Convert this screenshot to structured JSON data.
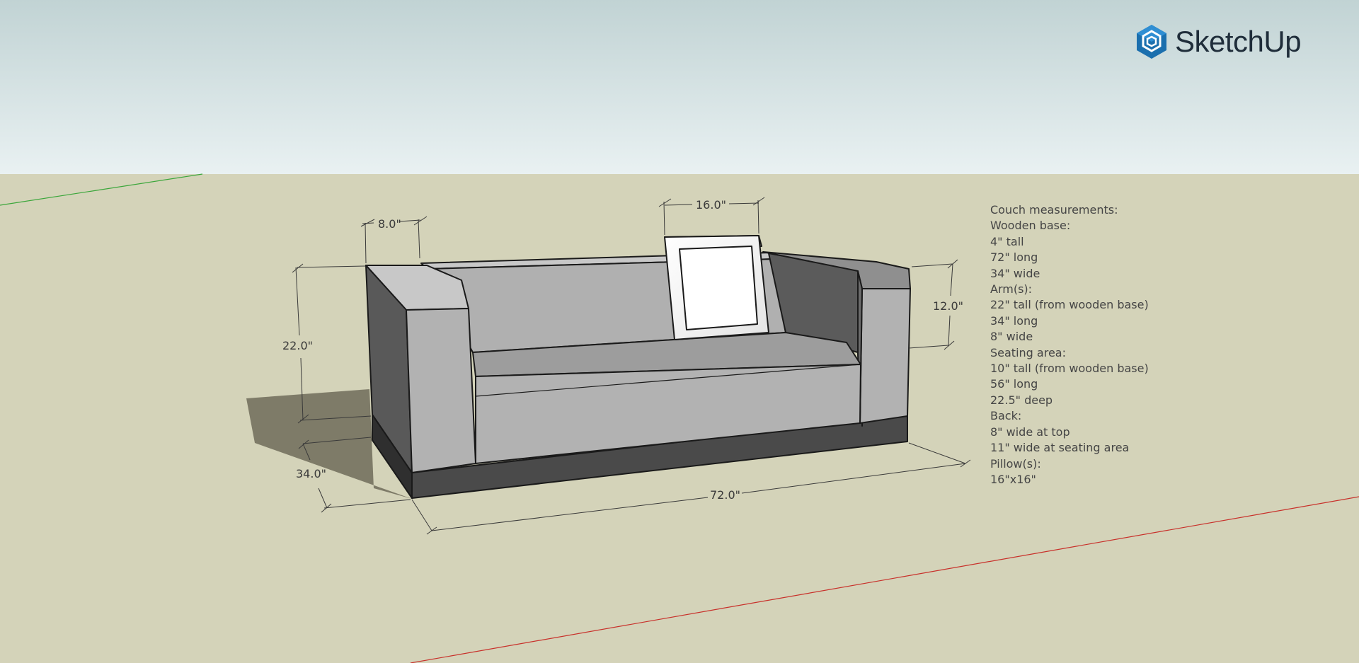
{
  "app": {
    "name": "SketchUp"
  },
  "colors": {
    "sky_top": "#c1d3d4",
    "sky_bottom": "#e9f1f2",
    "ground": "#d4d3b9",
    "green_axis": "#3aa63a",
    "red_axis": "#c8302a",
    "logo_blue": "#1b6fae"
  },
  "dimensions": {
    "arm_width": "8.0\"",
    "pillow_width": "16.0\"",
    "height_total": "22.0\"",
    "arm_height": "12.0\"",
    "depth": "34.0\"",
    "length": "72.0\""
  },
  "notes": [
    "Couch measurements:",
    "Wooden base:",
    "4\" tall",
    "72\" long",
    "34\" wide",
    "Arm(s):",
    "22\" tall (from wooden base)",
    "34\" long",
    "8\" wide",
    "Seating area:",
    "10\" tall (from wooden base)",
    "56\" long",
    "22.5\" deep",
    "Back:",
    "8\" wide at top",
    "11\" wide at seating area",
    "Pillow(s):",
    "16\"x16\""
  ]
}
